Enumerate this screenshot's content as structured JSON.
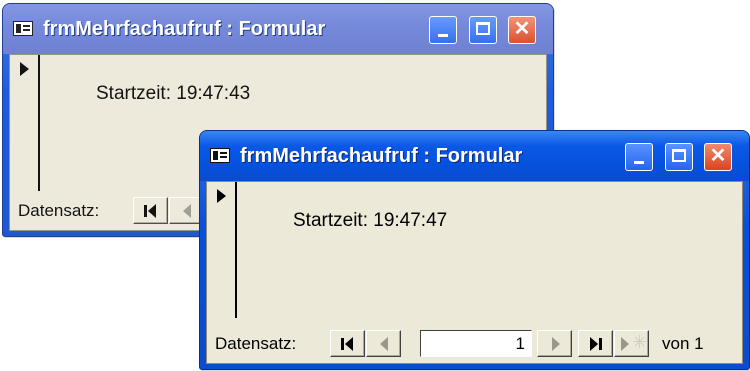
{
  "windows": [
    {
      "title": "frmMehrfachaufruf : Formular",
      "field": {
        "label": "Startzeit:",
        "value": "19:47:43"
      },
      "nav": {
        "label": "Datensatz:"
      }
    },
    {
      "title": "frmMehrfachaufruf : Formular",
      "field": {
        "label": "Startzeit:",
        "value": "19:47:47"
      },
      "nav": {
        "label": "Datensatz:",
        "current_record": "1",
        "of_label": "von",
        "total": "1"
      }
    }
  ],
  "icons": {
    "app": "form-icon",
    "minimize": "minimize-icon",
    "maximize": "maximize-icon",
    "close": "close-icon",
    "first": "first-record-icon",
    "prev": "previous-record-icon",
    "next": "next-record-icon",
    "last": "last-record-icon",
    "new": "new-record-icon",
    "pointer": "record-selector-icon"
  },
  "colors": {
    "titlebar_active": "#0a58e6",
    "titlebar_inactive": "#6a7fd8",
    "close_button": "#d9431e",
    "form_background": "#ece9d8"
  }
}
